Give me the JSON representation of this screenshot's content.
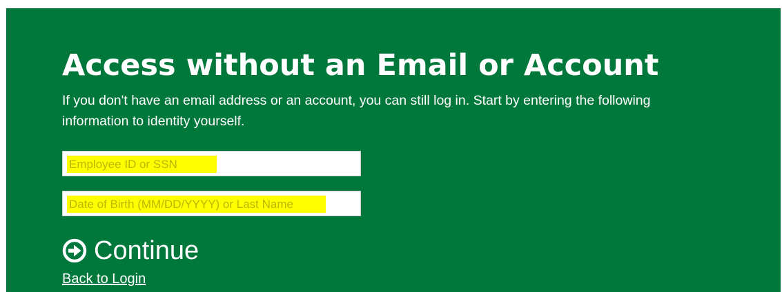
{
  "page": {
    "title": "Access without an Email or Account",
    "intro": "If you don't have an email address or an account, you can still log in. Start by entering the following information to identity yourself."
  },
  "form": {
    "employee_id": {
      "placeholder": "Employee ID or SSN",
      "value": ""
    },
    "dob_or_last_name": {
      "placeholder": "Date of Birth (MM/DD/YYYY) or Last Name",
      "value": ""
    }
  },
  "actions": {
    "continue_label": "Continue",
    "continue_icon": "arrow-right-circle-icon",
    "back_label": "Back to Login"
  },
  "colors": {
    "panel_background": "#00783c",
    "text": "#ffffff",
    "field_highlight": "#ffff00",
    "placeholder_text": "#bdb500"
  }
}
